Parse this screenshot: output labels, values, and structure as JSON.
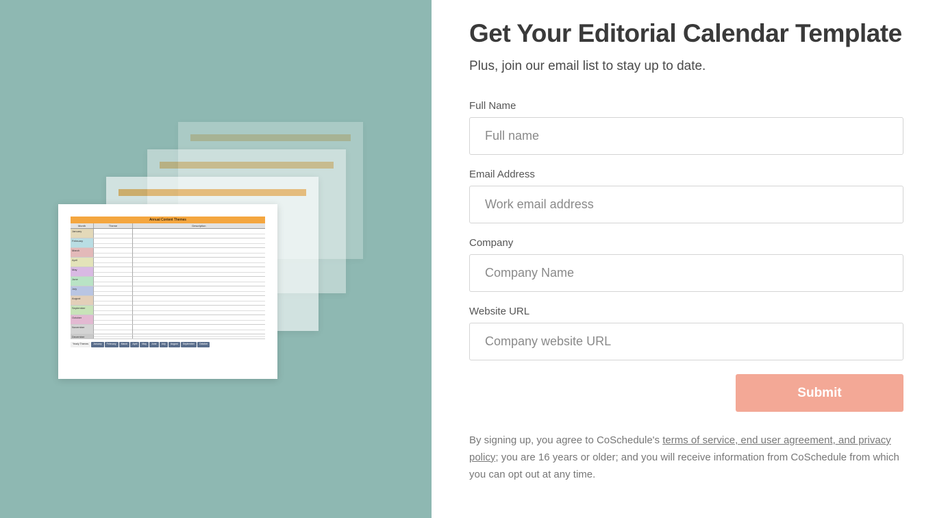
{
  "heading": "Get Your Editorial Calendar Template",
  "subheading": "Plus, join our email list to stay up to date.",
  "form": {
    "full_name": {
      "label": "Full Name",
      "placeholder": "Full name"
    },
    "email": {
      "label": "Email Address",
      "placeholder": "Work email address"
    },
    "company": {
      "label": "Company",
      "placeholder": "Company Name"
    },
    "website": {
      "label": "Website URL",
      "placeholder": "Company website URL"
    },
    "submit_label": "Submit"
  },
  "disclaimer": {
    "part1": "By signing up, you agree to CoSchedule's ",
    "link": "terms of service, end user agreement, and privacy policy",
    "part2": "; you are 16 years or older; and you will receive information from CoSchedule from which you can opt out at any time."
  },
  "preview": {
    "title": "Annual Content Themes",
    "col1": "Month",
    "col2": "Theme",
    "col3": "Description",
    "months": [
      "January",
      "February",
      "March",
      "April",
      "May",
      "June",
      "July",
      "August",
      "September",
      "October",
      "November",
      "December"
    ],
    "tabs": [
      "Yearly Themes",
      "January",
      "February",
      "March",
      "April",
      "May",
      "June",
      "July",
      "August",
      "September",
      "October"
    ]
  }
}
